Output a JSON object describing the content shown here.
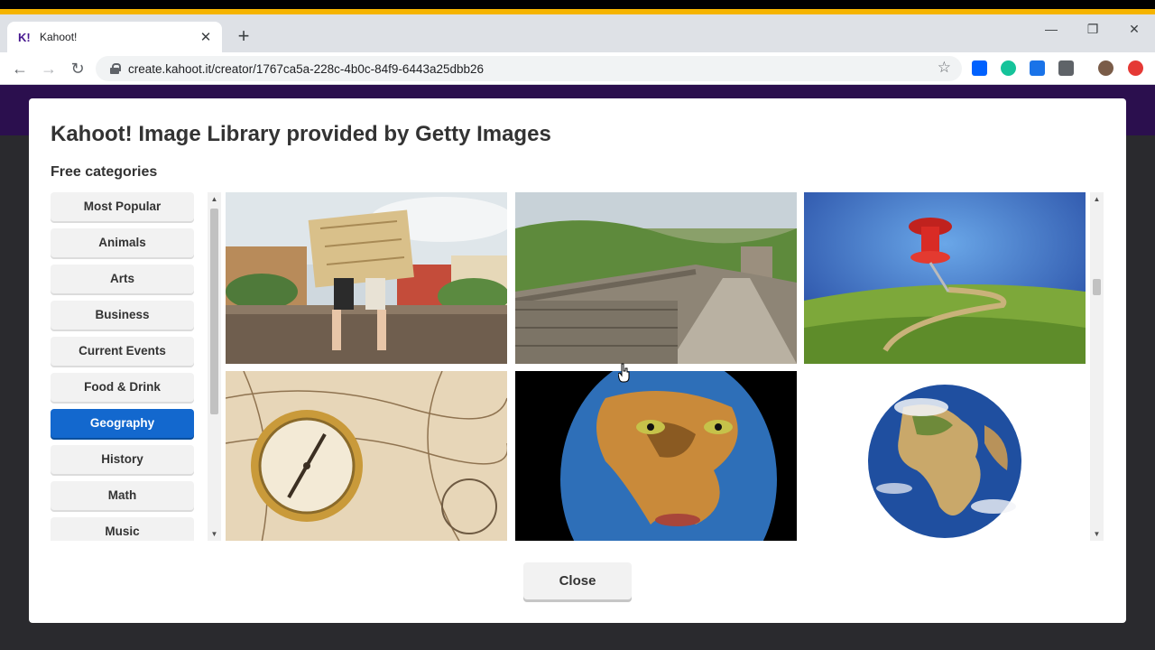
{
  "browser": {
    "tab_title": "Kahoot!",
    "tab_favicon": "K!",
    "url": "create.kahoot.it/creator/1767ca5a-228c-4b0c-84f9-6443a25dbb26"
  },
  "modal": {
    "title": "Kahoot! Image Library provided by Getty Images",
    "section_title": "Free categories",
    "close_label": "Close",
    "categories": [
      {
        "label": "Most Popular",
        "active": false
      },
      {
        "label": "Animals",
        "active": false
      },
      {
        "label": "Arts",
        "active": false
      },
      {
        "label": "Business",
        "active": false
      },
      {
        "label": "Current Events",
        "active": false
      },
      {
        "label": "Food & Drink",
        "active": false
      },
      {
        "label": "Geography",
        "active": true
      },
      {
        "label": "History",
        "active": false
      },
      {
        "label": "Math",
        "active": false
      },
      {
        "label": "Music",
        "active": false
      }
    ],
    "images": [
      {
        "icon": "travelers-map-image"
      },
      {
        "icon": "great-wall-image"
      },
      {
        "icon": "map-pin-field-image"
      },
      {
        "icon": "compass-map-image"
      },
      {
        "icon": "world-map-face-image"
      },
      {
        "icon": "earth-globe-image"
      }
    ]
  },
  "colors": {
    "accent": "#1368ce",
    "kahoot_purple": "#46178f"
  }
}
